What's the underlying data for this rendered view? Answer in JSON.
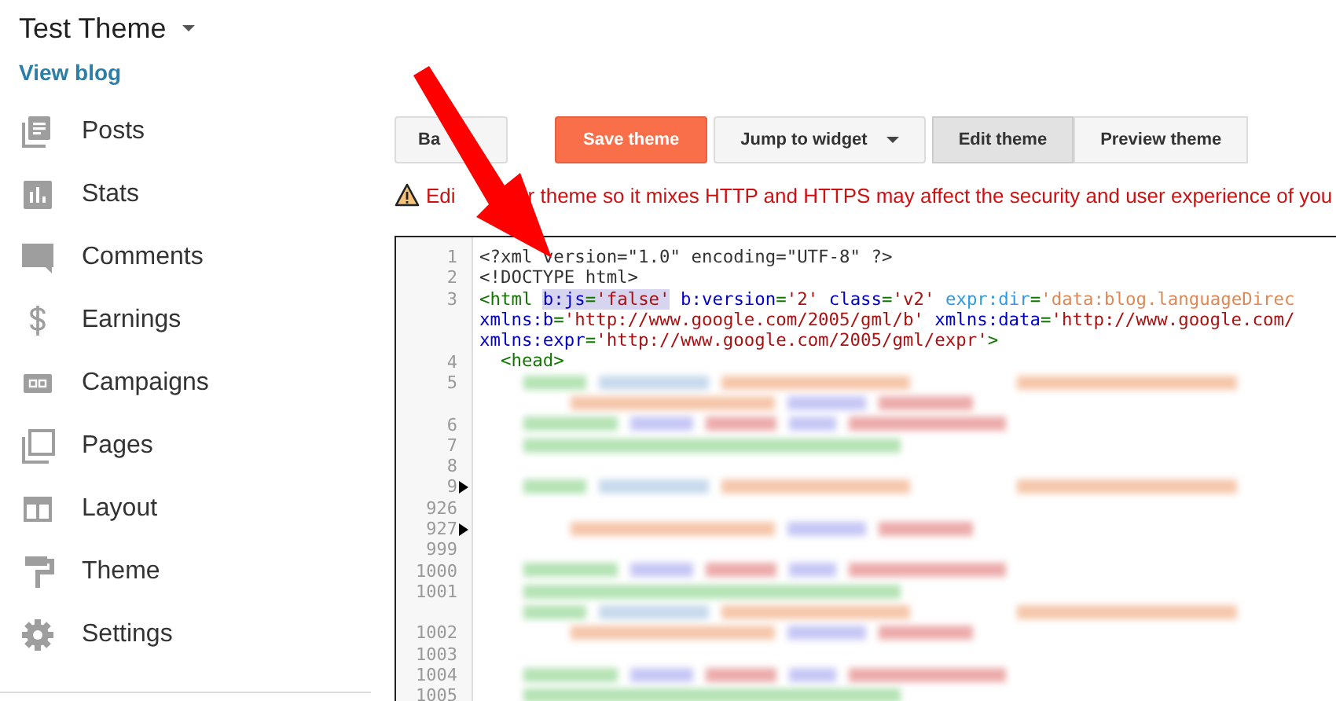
{
  "blog": {
    "title": "Test Theme",
    "view_link": "View blog"
  },
  "sidebar": {
    "items": [
      {
        "label": "Posts",
        "kind": "posts"
      },
      {
        "label": "Stats",
        "kind": "stats"
      },
      {
        "label": "Comments",
        "kind": "comments"
      },
      {
        "label": "Earnings",
        "kind": "earnings"
      },
      {
        "label": "Campaigns",
        "kind": "campaigns"
      },
      {
        "label": "Pages",
        "kind": "pages"
      },
      {
        "label": "Layout",
        "kind": "layout"
      },
      {
        "label": "Theme",
        "kind": "theme"
      },
      {
        "label": "Settings",
        "kind": "settings"
      }
    ]
  },
  "toolbar": {
    "buttons": [
      {
        "label": "Ba",
        "kind": "plain"
      },
      {
        "label": "Save theme",
        "kind": "primary"
      },
      {
        "label": "Jump to widget",
        "kind": "dropdown"
      }
    ],
    "view_tabs": [
      {
        "label": "Edit theme",
        "selected": true
      },
      {
        "label": "Preview theme",
        "selected": false
      }
    ]
  },
  "warning": {
    "parts": [
      "Edi",
      "r theme so it mixes HTTP and HTTPS may affect the security and user experience of you"
    ]
  },
  "editor": {
    "lines": [
      {
        "kind": "code",
        "number": "1",
        "tokens": [
          {
            "kind": "plain",
            "text": "<?xml version=\"1.0\" encoding=\"UTF-8\" ?>"
          }
        ]
      },
      {
        "kind": "code",
        "number": "2",
        "tokens": [
          {
            "kind": "plain",
            "text": "<!DOCTYPE html>"
          }
        ]
      },
      {
        "kind": "code",
        "number": "3",
        "tokens": [
          {
            "kind": "tag",
            "text": "<html "
          },
          {
            "kind": "attr",
            "text": "b:js",
            "highlight": true
          },
          {
            "kind": "tag",
            "text": "=",
            "highlight": true
          },
          {
            "kind": "string",
            "text": "'false'",
            "highlight": true
          },
          {
            "kind": "attr",
            "text": " b:version"
          },
          {
            "kind": "tag",
            "text": "="
          },
          {
            "kind": "string",
            "text": "'2'"
          },
          {
            "kind": "attr",
            "text": " class"
          },
          {
            "kind": "tag",
            "text": "="
          },
          {
            "kind": "string",
            "text": "'v2'"
          },
          {
            "kind": "expr",
            "text": " expr:dir"
          },
          {
            "kind": "tag",
            "text": "="
          },
          {
            "kind": "expstr",
            "text": "'data:blog.languageDirec"
          }
        ]
      },
      {
        "kind": "code",
        "tokens": [
          {
            "kind": "attr",
            "text": "xmlns:b"
          },
          {
            "kind": "tag",
            "text": "="
          },
          {
            "kind": "string",
            "text": "'http://www.google.com/2005/gml/b'"
          },
          {
            "kind": "attr",
            "text": " xmlns:data"
          },
          {
            "kind": "tag",
            "text": "="
          },
          {
            "kind": "string",
            "text": "'http://www.google.com/"
          }
        ]
      },
      {
        "kind": "code",
        "tokens": [
          {
            "kind": "attr",
            "text": "xmlns:expr"
          },
          {
            "kind": "tag",
            "text": "="
          },
          {
            "kind": "string",
            "text": "'http://www.google.com/2005/gml/expr'"
          },
          {
            "kind": "tag",
            "text": ">"
          }
        ]
      },
      {
        "kind": "code",
        "number": "4",
        "tokens": [
          {
            "kind": "tag",
            "text": "  <head>"
          }
        ]
      },
      {
        "kind": "blurred",
        "number": "5"
      },
      {
        "kind": "blurred"
      },
      {
        "kind": "blurred",
        "number": "6"
      },
      {
        "kind": "blurred",
        "number": "7"
      },
      {
        "kind": "empty",
        "number": "8"
      },
      {
        "kind": "blurred",
        "number": "9",
        "folded": true
      },
      {
        "kind": "empty",
        "number": "926"
      },
      {
        "kind": "blurred",
        "number": "927",
        "folded": true
      },
      {
        "kind": "empty",
        "number": "999"
      },
      {
        "kind": "blurred",
        "number": "1000"
      },
      {
        "kind": "blurred",
        "number": "1001"
      },
      {
        "kind": "blurred"
      },
      {
        "kind": "blurred",
        "number": "1002"
      },
      {
        "kind": "empty",
        "number": "1003"
      },
      {
        "kind": "blurred",
        "number": "1004"
      },
      {
        "kind": "blurred",
        "number": "1005"
      }
    ]
  }
}
